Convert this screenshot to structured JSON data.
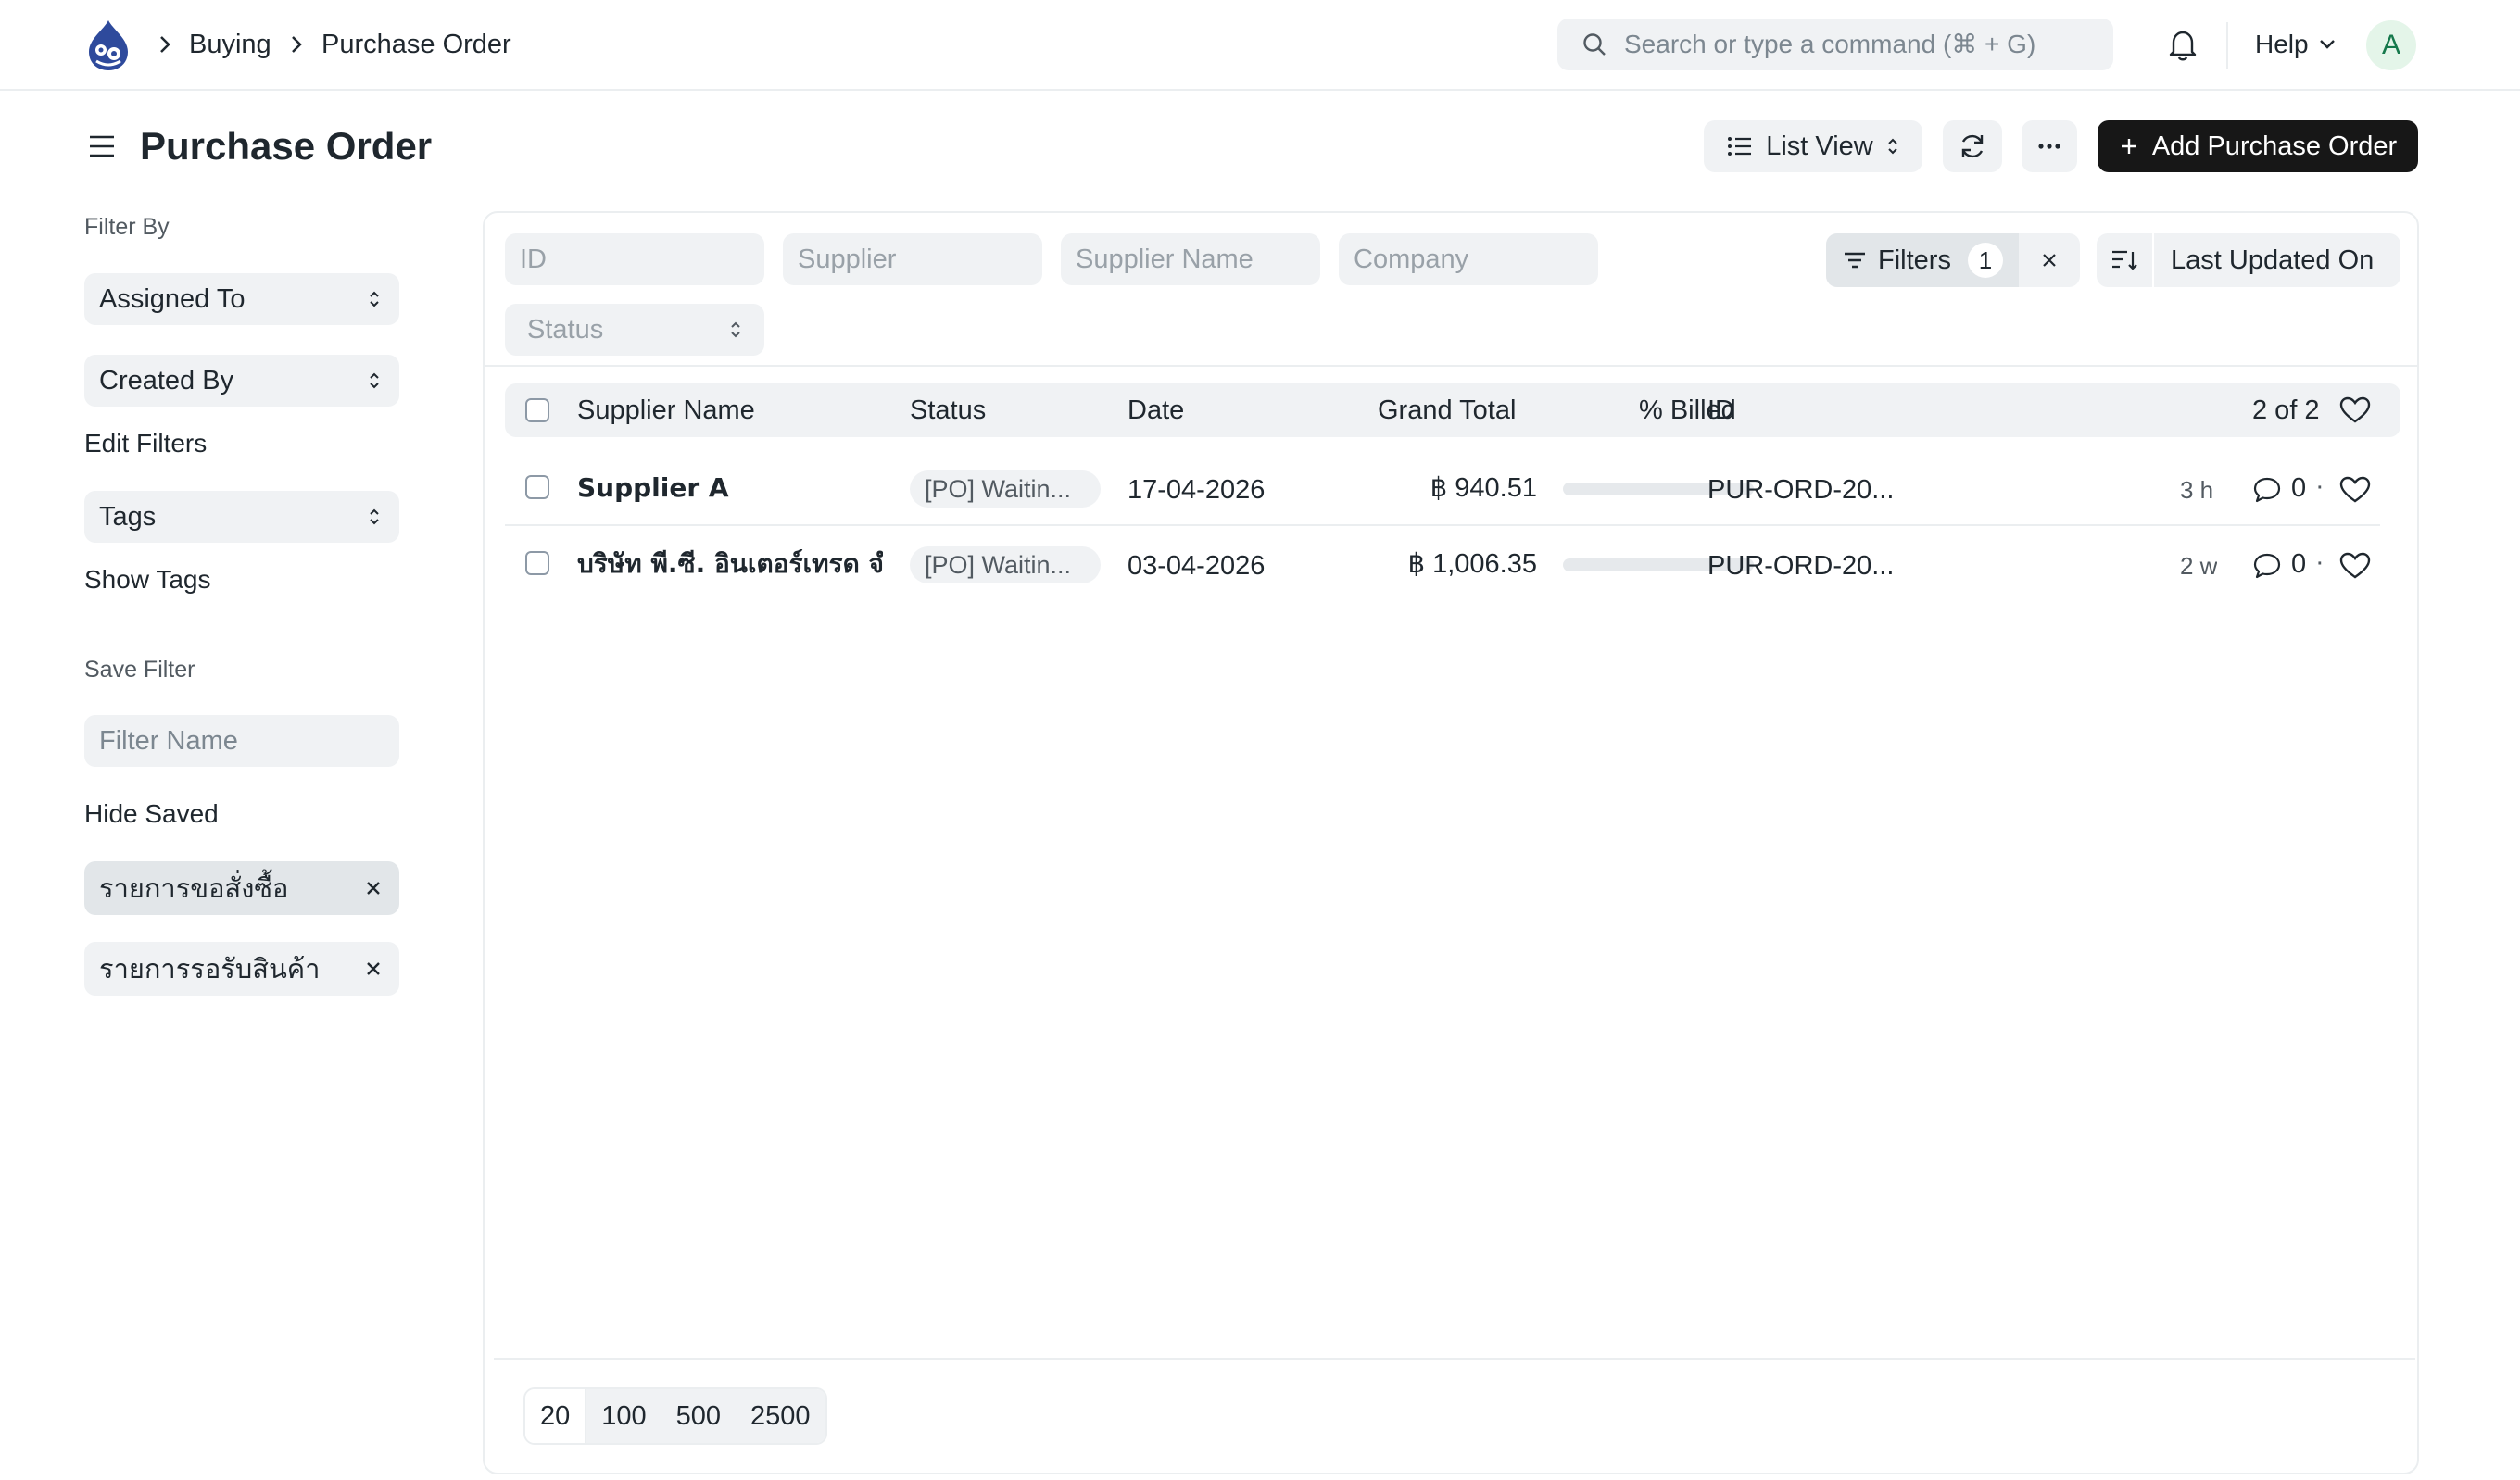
{
  "navbar": {
    "breadcrumbs": [
      "Buying",
      "Purchase Order"
    ],
    "search_placeholder": "Search or type a command (⌘ + G)",
    "help_label": "Help",
    "avatar_initial": "A"
  },
  "page": {
    "title": "Purchase Order",
    "list_view_label": "List View",
    "add_button_label": "Add Purchase Order"
  },
  "sidebar": {
    "filter_by_label": "Filter By",
    "assigned_to": "Assigned To",
    "created_by": "Created By",
    "edit_filters": "Edit Filters",
    "tags": "Tags",
    "show_tags": "Show Tags",
    "save_filter_label": "Save Filter",
    "filter_name_placeholder": "Filter Name",
    "hide_saved": "Hide Saved",
    "saved_filters": [
      "รายการขอสั่งซื้อ",
      "รายการรอรับสินค้า"
    ]
  },
  "filters": {
    "id_placeholder": "ID",
    "supplier_placeholder": "Supplier",
    "supplier_name_placeholder": "Supplier Name",
    "company_placeholder": "Company",
    "status_placeholder": "Status",
    "filters_label": "Filters",
    "filters_count": "1",
    "sort_label": "Last Updated On"
  },
  "table": {
    "columns": {
      "supplier_name": "Supplier Name",
      "status": "Status",
      "date": "Date",
      "grand_total": "Grand Total",
      "billed": "% Billed",
      "id": "ID",
      "count": "2 of 2"
    },
    "rows": [
      {
        "supplier_name": "Supplier A",
        "status": "[PO] Waitin...",
        "date": "17-04-2026",
        "grand_total": "฿ 940.51",
        "billed_percent": 0,
        "id": "PUR-ORD-20...",
        "ago": "3 h",
        "comments": "0"
      },
      {
        "supplier_name": "บริษัท พี.ซี. อินเตอร์เทรด จำกัด",
        "status": "[PO] Waitin...",
        "date": "03-04-2026",
        "grand_total": "฿ 1,006.35",
        "billed_percent": 0,
        "id": "PUR-ORD-20...",
        "ago": "2 w",
        "comments": "0"
      }
    ]
  },
  "paging": {
    "options": [
      "20",
      "100",
      "500",
      "2500"
    ],
    "selected": "20"
  },
  "colors": {
    "primary_button": "#171717",
    "control_bg": "#f0f2f4",
    "border": "#ebeef0",
    "avatar_bg": "#e4f5e9",
    "avatar_text": "#16794c"
  }
}
